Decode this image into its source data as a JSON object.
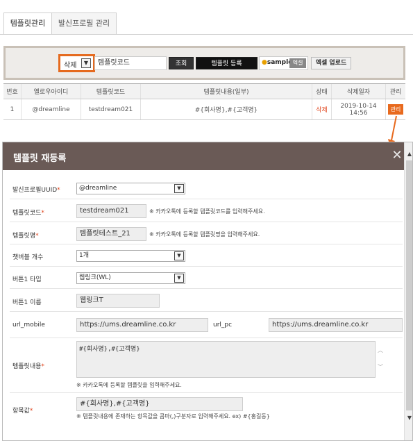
{
  "tabs": [
    {
      "label": "템플릿관리",
      "active": true
    },
    {
      "label": "발신프로필 관리",
      "active": false
    }
  ],
  "filter": {
    "select_value": "삭제",
    "search_value": "템플릿코드",
    "search_button": "조회",
    "register_button": "템플릿 등록",
    "sample_label": "sample",
    "excel_label": "엑셀",
    "upload_button": "엑셀 업로드"
  },
  "table": {
    "headers": [
      "번호",
      "옐로우아이디",
      "템플릿코드",
      "템플릿내용(일부)",
      "상태",
      "삭제일자",
      "관리"
    ],
    "rows": [
      {
        "no": "1",
        "yellow_id": "@dreamline",
        "code": "testdream021",
        "content": "#{회사명},#{고객명}",
        "status": "삭제",
        "date": "2019-10-14 14:56",
        "manage": "관리"
      }
    ]
  },
  "modal": {
    "title": "템플릿 재등록",
    "fields": {
      "profile_label": "발신프로필UUID",
      "profile_value": "@dreamline",
      "code_label": "템플릿코드",
      "code_value": "testdream021",
      "code_hint": "※ 카카오톡에 등록할 템플릿코드를 입력해주세요.",
      "name_label": "템플릿명",
      "name_value": "템플릿테스트_21",
      "name_hint": "※ 카카오톡에 등록할 템플릿명을 입력해주세요.",
      "button_count_label": "챗버블 개수",
      "button_count_value": "1개",
      "button1_type_label": "버튼1 타입",
      "button1_type_value": "웹링크(WL)",
      "button1_name_label": "버튼1 이름",
      "button1_name_value": "웹링크T",
      "url_mobile_label": "url_mobile",
      "url_mobile_value": "https://ums.dreamline.co.kr",
      "url_pc_label": "url_pc",
      "url_pc_value": "https://ums.dreamline.co.kr",
      "content_label": "템플릿내용",
      "content_value": "#{회사명},#{고객명}",
      "content_hint": "※ 카카오톡에 등록할 템플릿을 입력해주세요.",
      "items_label": "항목값",
      "items_value": "#{회사명},#{고객명}",
      "items_hint": "※ 템플릿내용에 존재하는 항목값을 콤마(,)구분자로 입력해주세요. ex) #{홍길동}"
    }
  },
  "colors": {
    "accent_orange": "#e86a1e",
    "modal_header": "#6a5a56",
    "required_red": "#e0441c"
  }
}
